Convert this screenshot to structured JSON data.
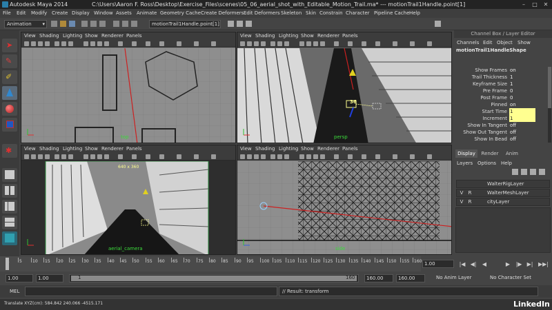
{
  "titlebar": {
    "app_title": "Autodesk Maya 2014",
    "file_path": "C:\\Users\\Aaron F. Ross\\Desktop\\Exercise_Files\\scenes\\05_06_aerial_shot_with_Editable_Motion_Trail.ma*  ---  motionTrail1Handle.point[1]",
    "minimize": "–",
    "maximize": "□",
    "close": "✕"
  },
  "menubar": {
    "items": [
      "File",
      "Edit",
      "Modify",
      "Create",
      "Display",
      "Window",
      "Assets",
      "Animate",
      "Geometry Cache",
      "Create Deformers",
      "Edit Deformers",
      "Skeleton",
      "Skin",
      "Constrain",
      "Character",
      "Pipeline Cache",
      "Help"
    ]
  },
  "statusline": {
    "mode": "Animation",
    "selection_field": "motionTrail1Handle.point[1]"
  },
  "viewport_menu": [
    "View",
    "Shading",
    "Lighting",
    "Show",
    "Renderer",
    "Panels"
  ],
  "viewports": {
    "top": {
      "label": "top"
    },
    "persp": {
      "label": "persp",
      "frame_marker": "36"
    },
    "aerial_camera": {
      "label": "aerial_camera",
      "resolution": "640 x 360"
    },
    "side": {
      "label": "side"
    }
  },
  "channelbox": {
    "header": "Channel Box / Layer Editor",
    "menu": [
      "Channels",
      "Edit",
      "Object",
      "Show"
    ],
    "node": "motionTrail1HandleShape",
    "attrs": [
      {
        "name": "Show Frames",
        "value": "on"
      },
      {
        "name": "Trail Thickness",
        "value": "1"
      },
      {
        "name": "Keyframe Size",
        "value": "1"
      },
      {
        "name": "Pre Frame",
        "value": "0"
      },
      {
        "name": "Post Frame",
        "value": "0"
      },
      {
        "name": "Pinned",
        "value": "on"
      },
      {
        "name": "Start Time",
        "value": "1"
      },
      {
        "name": "Increment",
        "value": "1"
      },
      {
        "name": "Show In Tangent",
        "value": "off"
      },
      {
        "name": "Show Out Tangent",
        "value": "off"
      },
      {
        "name": "Show In Bead",
        "value": "off"
      }
    ]
  },
  "layereditor": {
    "tabs": [
      "Display",
      "Render",
      "Anim"
    ],
    "menu": [
      "Layers",
      "Options",
      "Help"
    ],
    "layers": [
      {
        "v": "",
        "r": "",
        "name": "WalterRigLayer"
      },
      {
        "v": "V",
        "r": "R",
        "name": "WalterMeshLayer"
      },
      {
        "v": "V",
        "r": "R",
        "name": "cityLayer"
      }
    ]
  },
  "timeline": {
    "ticks": [
      "1",
      "5",
      "10",
      "15",
      "20",
      "25",
      "30",
      "35",
      "40",
      "45",
      "50",
      "55",
      "60",
      "65",
      "70",
      "75",
      "80",
      "85",
      "90",
      "95",
      "100",
      "105",
      "110",
      "115",
      "120",
      "125",
      "130",
      "135",
      "140",
      "145",
      "150",
      "155",
      "160"
    ],
    "current_frame": "1.00",
    "playback_buttons": [
      "|◀",
      "◀|",
      "◀",
      "▶",
      "|▶",
      "▶|",
      "▶▶|"
    ]
  },
  "rangebar": {
    "start": "1.00",
    "playback_start": "1.00",
    "range_start": "1",
    "range_end": "160",
    "playback_end": "160.00",
    "end": "160.00",
    "anim_layer": "No Anim Layer",
    "character_set": "No Character Set"
  },
  "cmdline": {
    "mel_label": "MEL",
    "result": "// Result: transform"
  },
  "helpline": {
    "text": "Translate XYZ(cm):   584.842     240.066   -4515.171"
  },
  "watermark": "LinkedIn",
  "colors": {
    "grid_bg": "#8e8e8e",
    "persp_bg": "#6a6a6a",
    "highlight": "#ffff90",
    "label_green": "#3cdc3c",
    "trail_red": "#cc2020"
  }
}
